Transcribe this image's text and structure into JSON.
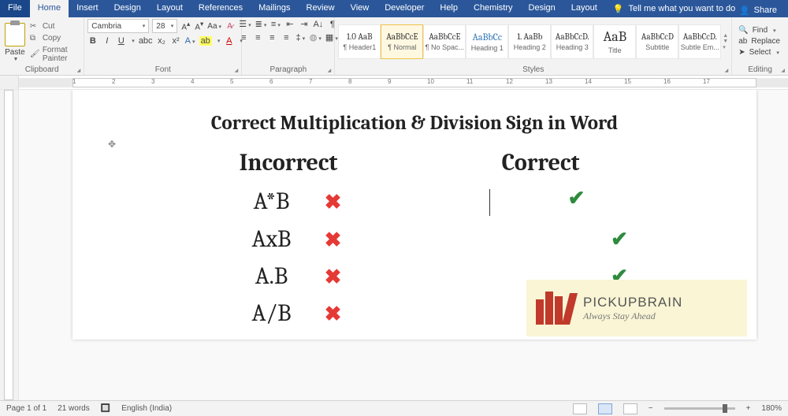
{
  "menu": {
    "file": "File",
    "home": "Home",
    "insert": "Insert",
    "design": "Design",
    "layout": "Layout",
    "references": "References",
    "mailings": "Mailings",
    "review": "Review",
    "view": "View",
    "developer": "Developer",
    "help": "Help",
    "chemistry": "Chemistry",
    "design2": "Design",
    "layout2": "Layout"
  },
  "tellme": "Tell me what you want to do",
  "share": "Share",
  "clipboard": {
    "paste": "Paste",
    "cut": "Cut",
    "copy": "Copy",
    "format_painter": "Format Painter",
    "label": "Clipboard"
  },
  "font": {
    "name": "Cambria",
    "size": "28",
    "label": "Font",
    "bold": "B",
    "italic": "I",
    "underline": "U"
  },
  "paragraph": {
    "label": "Paragraph"
  },
  "styles": {
    "label": "Styles",
    "items": [
      {
        "sample": "1.0 AaB",
        "name": "¶ Header1"
      },
      {
        "sample": "AaBbCcE",
        "name": "¶ Normal"
      },
      {
        "sample": "AaBbCcE",
        "name": "¶ No Spac..."
      },
      {
        "sample": "AaBbCc",
        "name": "Heading 1"
      },
      {
        "sample": "1. AaBb",
        "name": "Heading 2"
      },
      {
        "sample": "AaBbCcD.",
        "name": "Heading 3"
      },
      {
        "sample": "AaB",
        "name": "Title"
      },
      {
        "sample": "AaBbCcD",
        "name": "Subtitle"
      },
      {
        "sample": "AaBbCcD.",
        "name": "Subtle Em..."
      }
    ]
  },
  "editing": {
    "find": "Find",
    "replace": "Replace",
    "select": "Select",
    "label": "Editing"
  },
  "ruler_numbers": [
    "1",
    "2",
    "3",
    "4",
    "5",
    "6",
    "7",
    "8",
    "9",
    "10",
    "11",
    "12",
    "13",
    "14",
    "15",
    "16",
    "17"
  ],
  "doc": {
    "title": "Correct Multiplication & Division Sign in Word",
    "col_incorrect": "Incorrect",
    "col_correct": "Correct",
    "rows": [
      {
        "expr": "A*B",
        "correct": ""
      },
      {
        "expr": "AxB",
        "correct": ""
      },
      {
        "expr": "A.B",
        "correct": ""
      },
      {
        "expr": "A/B",
        "correct": ""
      }
    ]
  },
  "watermark": {
    "line1": "PICKUPBRAIN",
    "line2": "Always Stay Ahead"
  },
  "status": {
    "page": "Page 1 of 1",
    "words": "21 words",
    "lang": "English (India)",
    "zoom": "180%"
  }
}
